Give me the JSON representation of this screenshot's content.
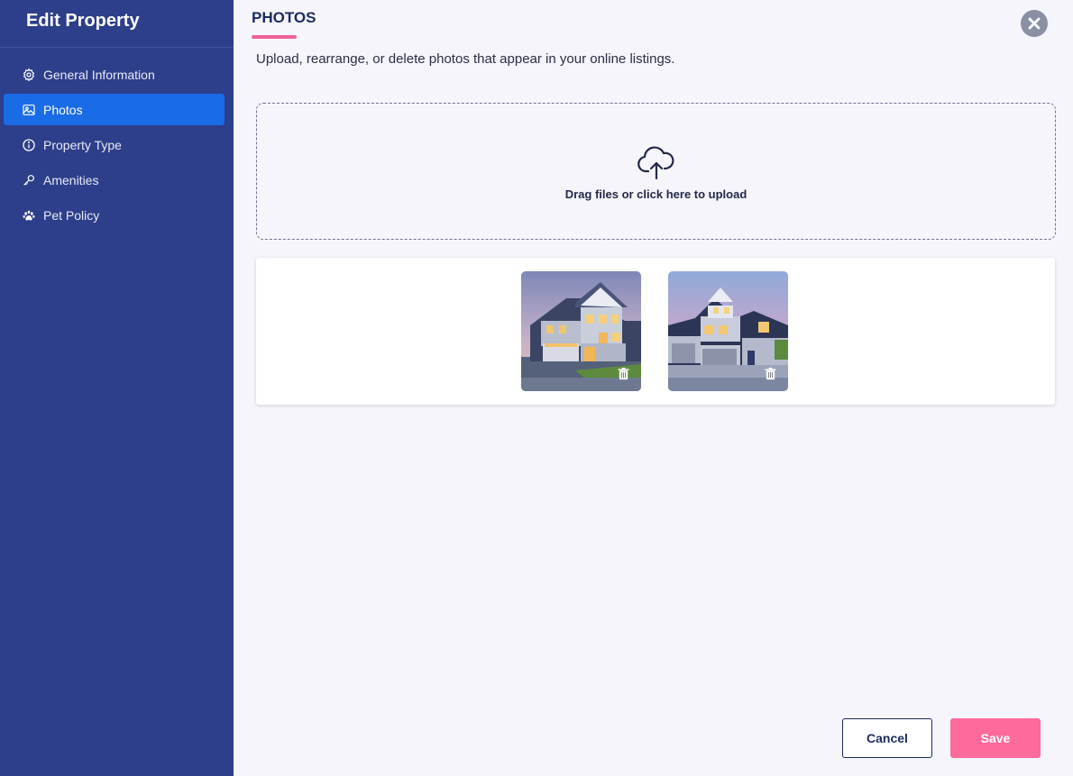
{
  "sidebar": {
    "title": "Edit Property",
    "items": [
      {
        "label": "General Information",
        "icon": "gear-icon",
        "active": false
      },
      {
        "label": "Photos",
        "icon": "image-icon",
        "active": true
      },
      {
        "label": "Property Type",
        "icon": "info-icon",
        "active": false
      },
      {
        "label": "Amenities",
        "icon": "key-icon",
        "active": false
      },
      {
        "label": "Pet Policy",
        "icon": "paw-icon",
        "active": false
      }
    ]
  },
  "main": {
    "title": "PHOTOS",
    "subtitle": "Upload, rearrange, or delete photos that appear in your online listings.",
    "dropzone": {
      "text": "Drag files or click here to upload",
      "icon": "cloud-upload-icon"
    },
    "photos": [
      {
        "icon": "trash-icon"
      },
      {
        "icon": "trash-icon"
      }
    ]
  },
  "actions": {
    "cancel_label": "Cancel",
    "save_label": "Save"
  },
  "colors": {
    "sidebar_bg": "#2d3e8a",
    "active_item": "#1a6be6",
    "accent_pink": "#ff6a9d",
    "title_underline": "#f0609a",
    "heading_navy": "#1c2b5e"
  }
}
